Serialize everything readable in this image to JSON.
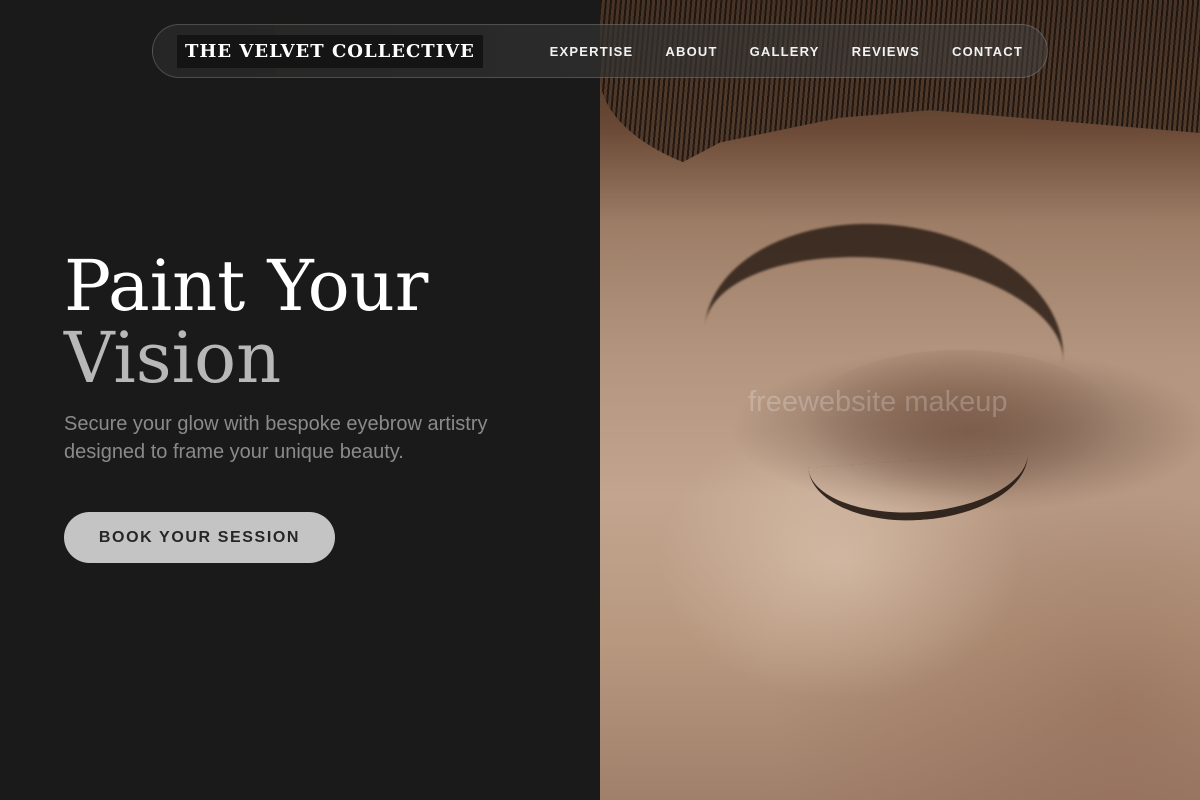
{
  "brand": {
    "name": "THE VELVET COLLECTIVE"
  },
  "nav": {
    "items": [
      {
        "label": "EXPERTISE"
      },
      {
        "label": "ABOUT"
      },
      {
        "label": "GALLERY"
      },
      {
        "label": "REVIEWS"
      },
      {
        "label": "CONTACT"
      }
    ]
  },
  "hero": {
    "title_line1": "Paint Your",
    "title_line2": "Vision",
    "subtitle": "Secure your glow with bespoke eyebrow artistry designed to frame your unique beauty.",
    "cta_label": "BOOK YOUR SESSION"
  },
  "image": {
    "watermark": "freewebsite makeup"
  },
  "colors": {
    "background": "#1a1a1a",
    "title_primary": "#ffffff",
    "title_secondary": "#b8b8b8",
    "subtitle": "#8a8a8a",
    "cta_background": "#c4c4c4",
    "cta_text": "#262626"
  }
}
